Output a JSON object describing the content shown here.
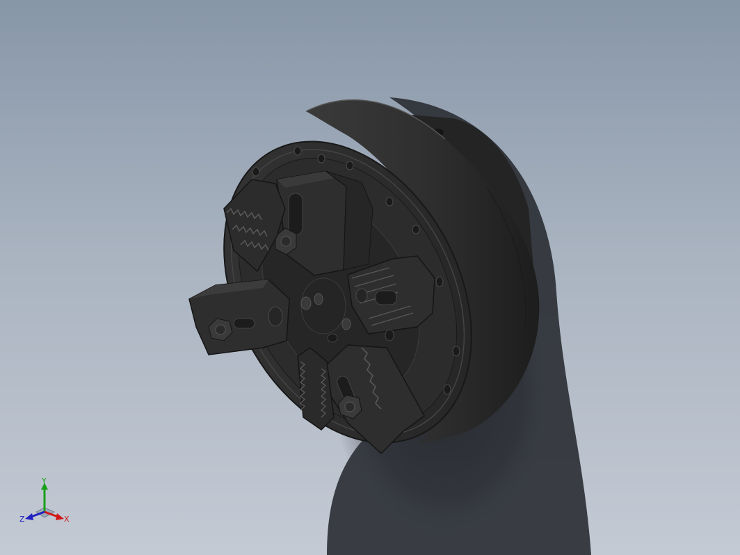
{
  "viewport": {
    "background_top": "#8796a8",
    "background_bottom": "#c4cad4",
    "model_color": "#2a2a2a"
  },
  "model": {
    "icon": "chuck-model-icon",
    "jaw_count": 4
  },
  "triad": {
    "x_label": "X",
    "y_label": "Y",
    "z_label": "Z",
    "x_color": "#d01818",
    "y_color": "#18a018",
    "z_color": "#2020c0"
  }
}
